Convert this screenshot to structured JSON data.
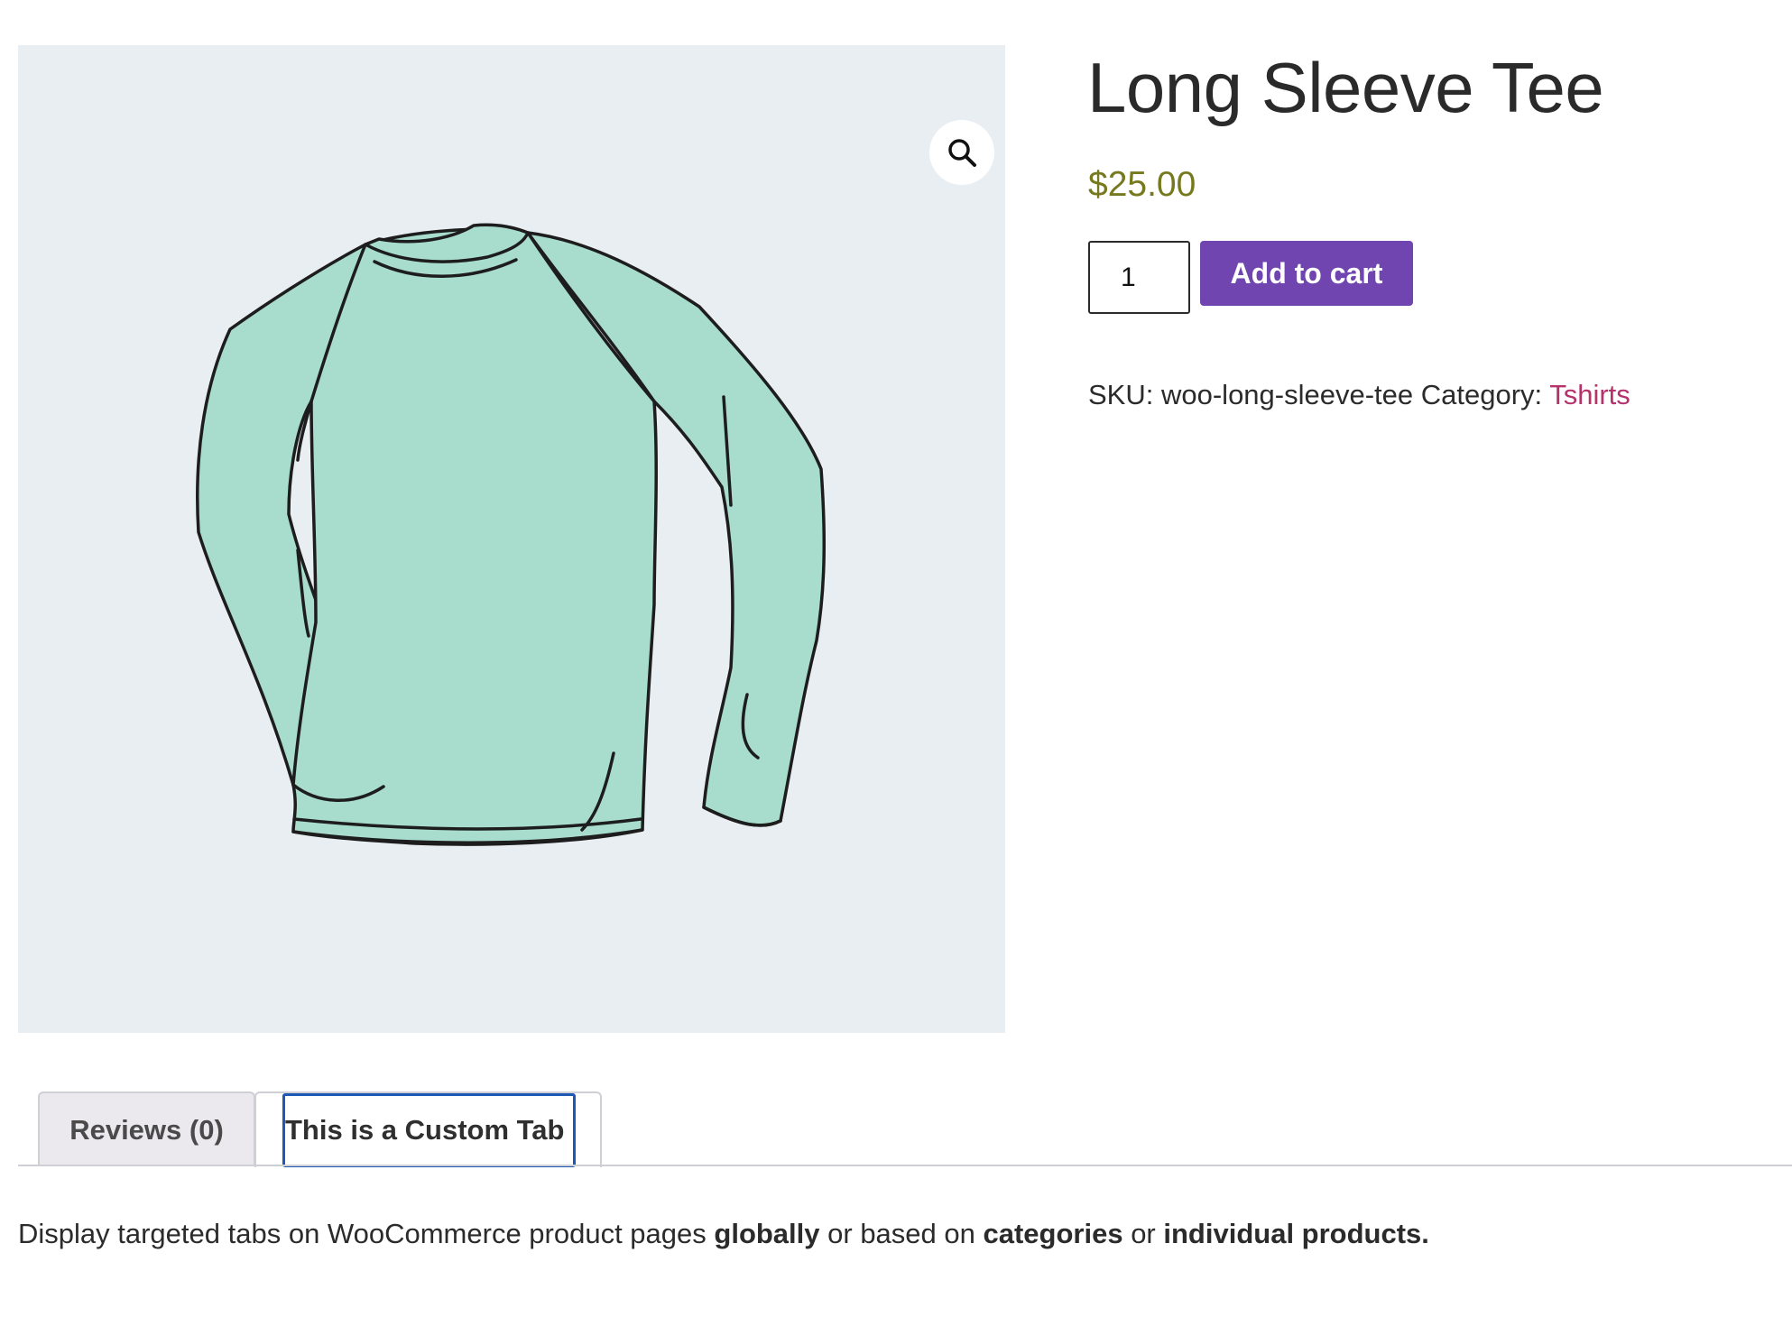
{
  "product": {
    "title": "Long Sleeve Tee",
    "price": "$25.00",
    "quantity": "1",
    "add_to_cart_label": "Add to cart",
    "sku_label": "SKU:",
    "sku": "woo-long-sleeve-tee",
    "category_label": "Category:",
    "category": "Tshirts"
  },
  "gallery": {
    "zoom_icon": "magnifier-icon",
    "background": "#e9eef2",
    "shirt_color": "#a6d9cb"
  },
  "tabs": [
    {
      "label": "Reviews (0)",
      "active": false
    },
    {
      "label": "This is a Custom Tab",
      "active": true
    }
  ],
  "panel": {
    "t1": "Display targeted tabs on WooCommerce product pages ",
    "b1": "globally",
    "t2": " or based on ",
    "b2": "categories",
    "t3": " or ",
    "b3": "individual products."
  },
  "colors": {
    "accent_button": "#7045b0",
    "price": "#77791f",
    "category_link": "#b5336a",
    "focus_ring": "#1e58b5"
  }
}
